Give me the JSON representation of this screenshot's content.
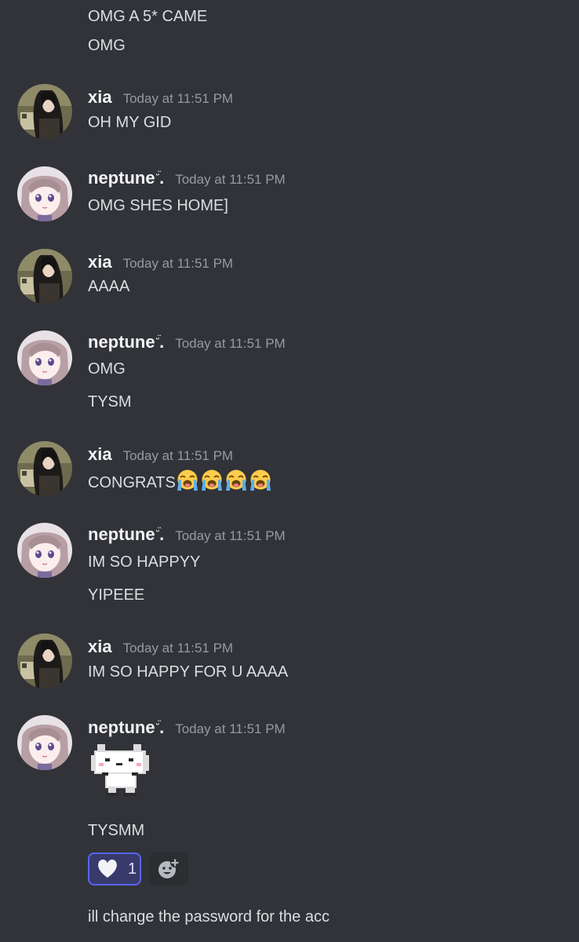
{
  "messages": [
    {
      "type": "continuation",
      "text": "OMG A 5* CAME"
    },
    {
      "type": "continuation",
      "text": "OMG"
    },
    {
      "type": "message",
      "author": "xia",
      "timestamp": "Today at 11:51 PM",
      "lines": [
        "OH MY GID"
      ]
    },
    {
      "type": "message",
      "author": "neptune",
      "author_suffix": ".",
      "timestamp": "Today at 11:51 PM",
      "lines": [
        "OMG SHES HOME]"
      ]
    },
    {
      "type": "message",
      "author": "xia",
      "timestamp": "Today at 11:51 PM",
      "lines": [
        "AAAA"
      ]
    },
    {
      "type": "message",
      "author": "neptune",
      "author_suffix": ".",
      "timestamp": "Today at 11:51 PM",
      "lines": [
        "OMG",
        "TYSM"
      ]
    },
    {
      "type": "message",
      "author": "xia",
      "timestamp": "Today at 11:51 PM",
      "lines": [
        "CONGRATS"
      ],
      "emoji": [
        "loudly-crying-face",
        "loudly-crying-face",
        "loudly-crying-face",
        "loudly-crying-face"
      ]
    },
    {
      "type": "message",
      "author": "neptune",
      "author_suffix": ".",
      "timestamp": "Today at 11:51 PM",
      "lines": [
        "IM SO HAPPYY",
        "YIPEEE"
      ]
    },
    {
      "type": "message",
      "author": "xia",
      "timestamp": "Today at 11:51 PM",
      "lines": [
        "IM SO HAPPY FOR U AAAA"
      ]
    },
    {
      "type": "message",
      "author": "neptune",
      "author_suffix": ".",
      "timestamp": "Today at 11:51 PM",
      "sticker": "pixel-cat-sticker",
      "lines": [
        "TYSMM",
        "ill change the password for the acc"
      ]
    }
  ],
  "reactions": [
    {
      "icon": "heart-icon",
      "count": "1",
      "active": true
    }
  ],
  "add_reaction_icon": "add-reaction-icon",
  "colors": {
    "background": "#313338",
    "username": "#f2f3f5",
    "timestamp": "#949ba4",
    "text": "#dbdee1",
    "reaction_border": "#5865f2"
  }
}
